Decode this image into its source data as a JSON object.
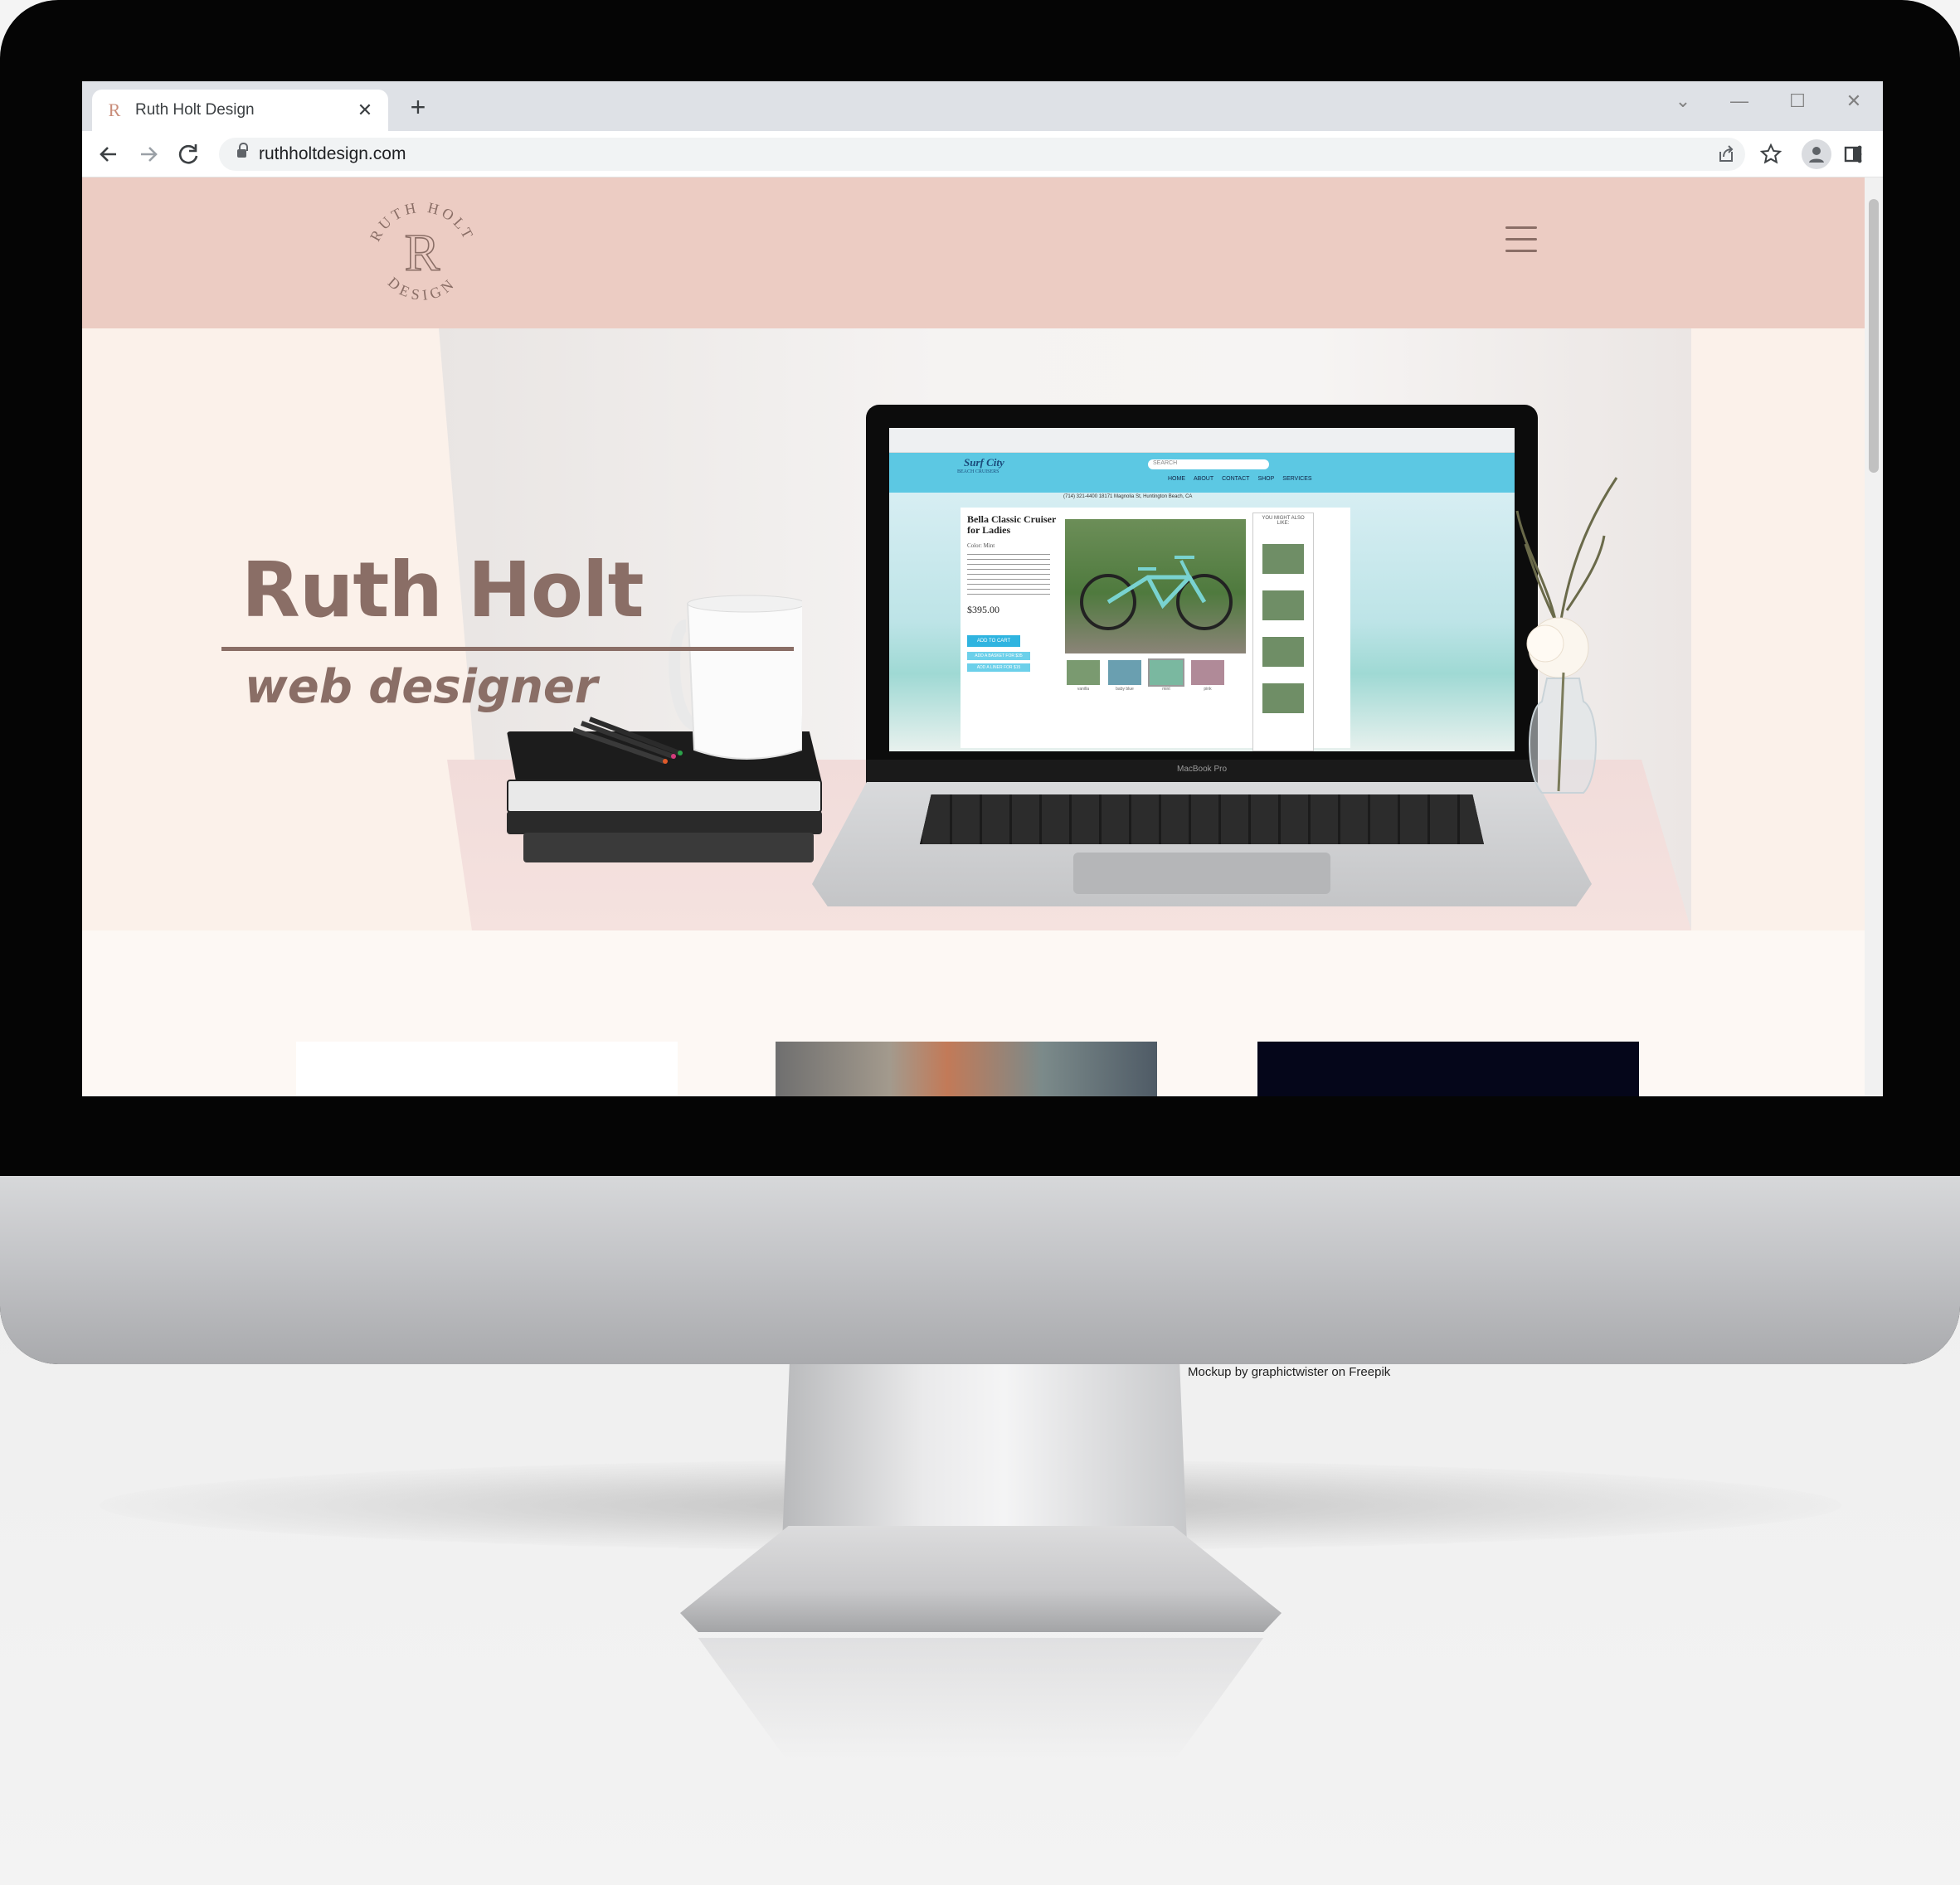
{
  "browser": {
    "tab_title": "Ruth Holt Design",
    "tab_favicon": "R",
    "tab_close": "✕",
    "new_tab": "+",
    "url": "ruthholtdesign.com",
    "window_controls": {
      "tab_search": "⌄",
      "minimize": "—",
      "maximize": "☐",
      "close": "✕"
    },
    "icons": [
      "back-icon",
      "forward-icon",
      "reload-icon",
      "lock-icon",
      "share-icon",
      "star-icon",
      "extensions-icon",
      "side-panel-icon",
      "profile-icon",
      "menu-icon"
    ]
  },
  "site": {
    "logo": {
      "top_arc": "RUTH HOLT",
      "monogram": "R",
      "bottom_arc": "DESIGN"
    },
    "hero": {
      "name": "Ruth Holt",
      "role": "web designer"
    },
    "colors": {
      "header_bg": "#ecccc3",
      "brand_brown": "#8a6e66",
      "hero_bg": "#fbf1ea"
    }
  },
  "laptop_screen": {
    "brand": "MacBook Pro",
    "site_name": "Surf City",
    "site_tagline": "BEACH CRUISERS",
    "search_placeholder": "SEARCH",
    "nav": [
      "HOME",
      "ABOUT",
      "CONTACT",
      "SHOP",
      "SERVICES"
    ],
    "address_bar": "(714) 321-4400   18171 Magnolia St, Huntington Beach, CA",
    "product_title": "Bella Classic Cruiser for Ladies",
    "product_color": "Color: Mint",
    "price": "$395.00",
    "add_to_cart": "ADD TO CART",
    "addon1": "ADD A BASKET FOR $35",
    "addon2": "ADD A LINER FOR $15",
    "swatches": [
      "vanilla",
      "baby blue",
      "mint",
      "pink"
    ],
    "sidebar_title": "YOU MIGHT ALSO LIKE:"
  },
  "credit": "Mockup by graphictwister on Freepik"
}
